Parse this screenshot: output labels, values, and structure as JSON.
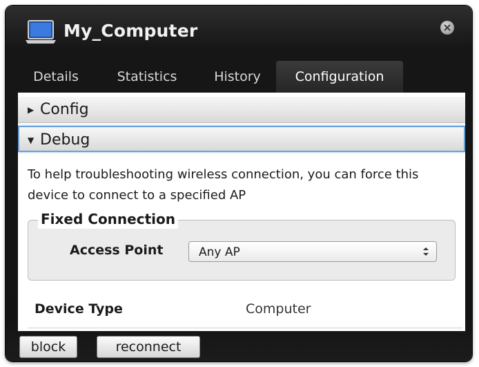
{
  "window": {
    "title": "My_Computer",
    "icon": "laptop-icon",
    "close_icon": "close-icon"
  },
  "tabs": [
    {
      "label": "Details"
    },
    {
      "label": "Statistics"
    },
    {
      "label": "History"
    },
    {
      "label": "Configuration",
      "active": true
    }
  ],
  "sections": {
    "config": {
      "label": "Config",
      "expanded": false
    },
    "debug": {
      "label": "Debug",
      "expanded": true
    }
  },
  "debug": {
    "help_text": "To help troubleshooting wireless connection, you can force this device to connect to a specified AP",
    "fixed_connection": {
      "legend": "Fixed Connection",
      "access_point_label": "Access Point",
      "access_point_value": "Any AP"
    }
  },
  "device": {
    "type_label": "Device Type",
    "type_value": "Computer"
  },
  "footer": {
    "block_label": "block",
    "reconnect_label": "reconnect"
  },
  "colors": {
    "focus_border": "#6aa0d8",
    "window_bg": "#161616"
  }
}
